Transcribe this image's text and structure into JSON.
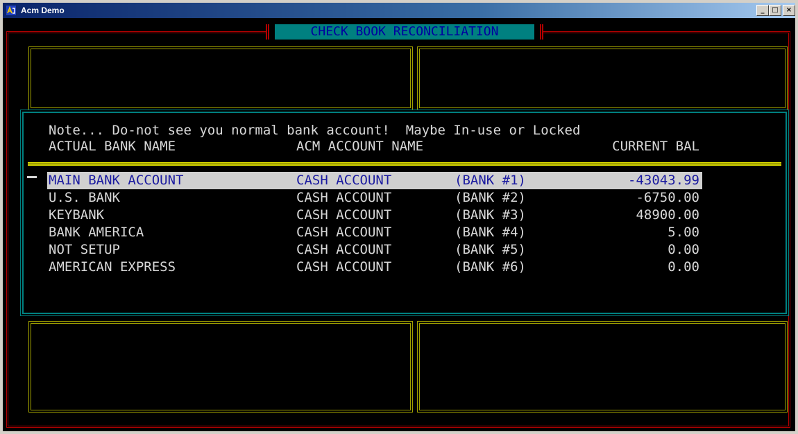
{
  "window": {
    "title": "Acm Demo",
    "min_label": "_",
    "max_label": "□",
    "close_label": "×"
  },
  "screen": {
    "title": "CHECK BOOK RECONCILIATION"
  },
  "dialog": {
    "note": "Note... Do-not see you normal bank account!  Maybe In-use or Locked",
    "headers": {
      "bank": "ACTUAL BANK NAME",
      "acm": "ACM ACCOUNT NAME",
      "balance": "CURRENT BAL"
    },
    "rows": [
      {
        "bank": "MAIN BANK ACCOUNT",
        "acm": "CASH ACCOUNT",
        "num": "(BANK #1)",
        "balance": "-43043.99"
      },
      {
        "bank": "U.S. BANK",
        "acm": "CASH ACCOUNT",
        "num": "(BANK #2)",
        "balance": "-6750.00"
      },
      {
        "bank": "KEYBANK",
        "acm": "CASH ACCOUNT",
        "num": "(BANK #3)",
        "balance": "48900.00"
      },
      {
        "bank": "BANK AMERICA",
        "acm": "CASH ACCOUNT",
        "num": "(BANK #4)",
        "balance": "5.00"
      },
      {
        "bank": "NOT SETUP",
        "acm": "CASH ACCOUNT",
        "num": "(BANK #5)",
        "balance": "0.00"
      },
      {
        "bank": "AMERICAN EXPRESS",
        "acm": "CASH ACCOUNT",
        "num": "(BANK #6)",
        "balance": "0.00"
      }
    ],
    "selected_index": 0
  },
  "colors": {
    "console_bg": "#000000",
    "text": "#d8d8d8",
    "title_bg": "#008080",
    "title_text": "#0000a0",
    "frame_red": "#b00000",
    "frame_yellow": "#a0a000",
    "frame_cyan": "#008080",
    "separator": "#e8e800",
    "selection_bg": "#d0d0d0",
    "selection_text": "#1a1aa0"
  },
  "icons": {
    "app": "acm-app-icon"
  }
}
